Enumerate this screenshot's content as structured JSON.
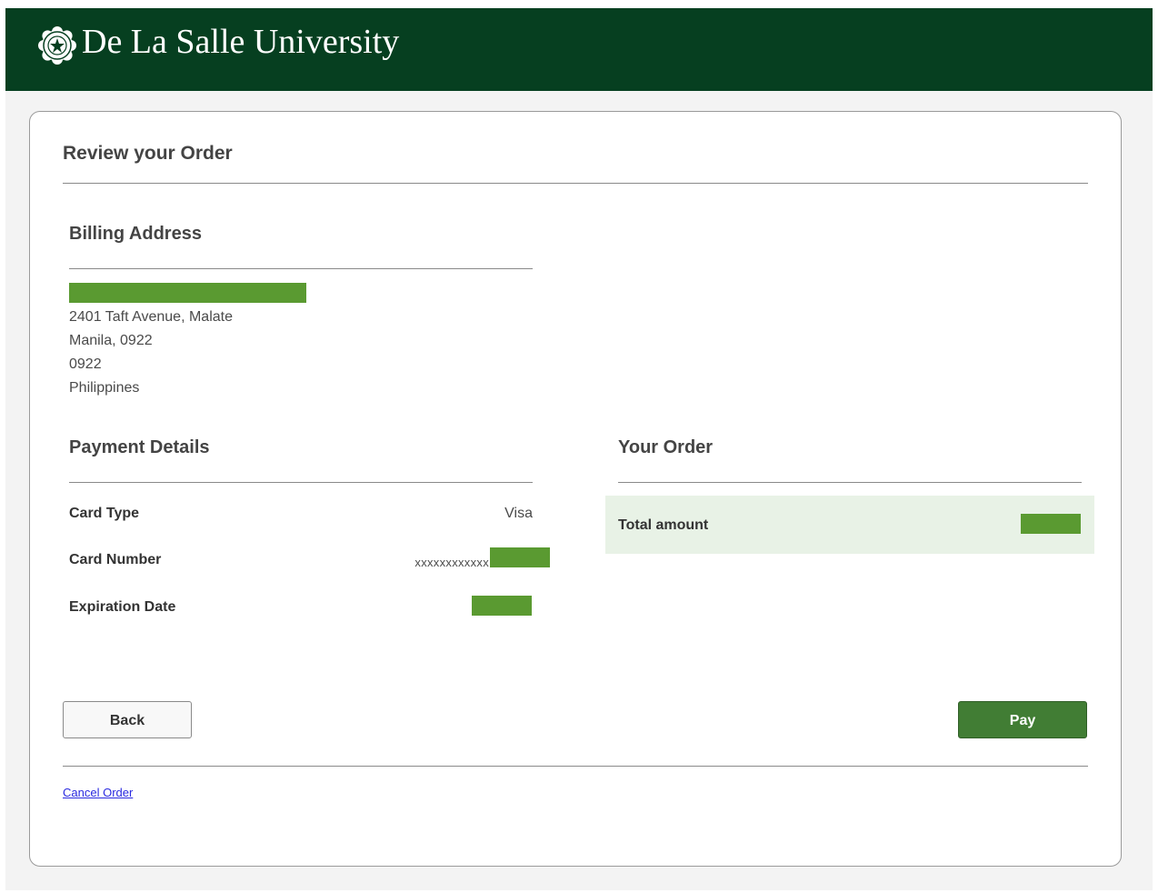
{
  "header": {
    "brand_name": "De La Salle University",
    "logo_icon": "university-seal-icon",
    "background_color": "#063f20"
  },
  "review": {
    "title": "Review your Order"
  },
  "billing": {
    "title": "Billing Address",
    "name_redacted": true,
    "address_lines": [
      "2401 Taft Avenue, Malate",
      "Manila, 0922",
      "0922",
      "Philippines"
    ]
  },
  "payment": {
    "title": "Payment Details",
    "rows": [
      {
        "label": "Card Type",
        "value": "Visa"
      },
      {
        "label": "Card Number",
        "value": "xxxxxxxxxxxx"
      },
      {
        "label": "Expiration Date",
        "value": ""
      }
    ]
  },
  "order": {
    "title": "Your Order",
    "total_label": "Total amount"
  },
  "actions": {
    "back_label": "Back",
    "pay_label": "Pay",
    "cancel_label": "Cancel Order"
  },
  "colors": {
    "brand_green": "#063f20",
    "pay_button": "#417d34",
    "redaction": "#5a9a31",
    "total_highlight": "#e8f2e6",
    "link": "#2a2ae0"
  }
}
